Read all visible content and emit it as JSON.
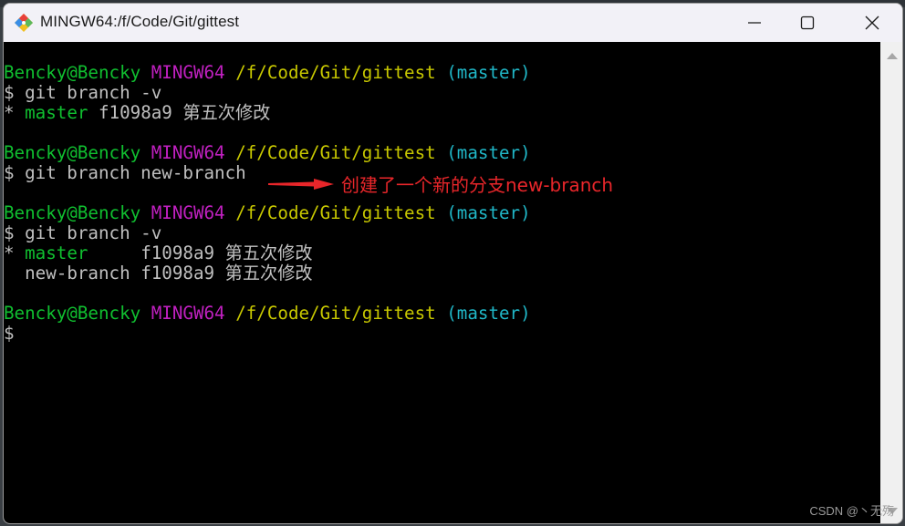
{
  "window": {
    "title": "MINGW64:/f/Code/Git/gittest",
    "app_icon": "git-logo-icon",
    "controls": {
      "minimize": "minimize-icon",
      "maximize": "maximize-icon",
      "close": "close-icon"
    }
  },
  "terminal": {
    "colors": {
      "user": "#10c030",
      "system": "#c020c0",
      "path": "#c8c800",
      "branch": "#20b8c8",
      "text": "#c0c0c0",
      "annotation": "#e8262a"
    },
    "blocks": [
      {
        "prompt": {
          "user": "Bencky@Bencky",
          "system": "MINGW64",
          "path": "/f/Code/Git/gittest",
          "branch": "(master)"
        },
        "command": "$ git branch -v",
        "output": [
          {
            "marker": "* ",
            "branch": "master",
            "pad": " ",
            "hash": "f1098a9",
            "message": "第五次修改",
            "current": true
          }
        ]
      },
      {
        "prompt": {
          "user": "Bencky@Bencky",
          "system": "MINGW64",
          "path": "/f/Code/Git/gittest",
          "branch": "(master)"
        },
        "command": "$ git branch new-branch",
        "output": []
      },
      {
        "prompt": {
          "user": "Bencky@Bencky",
          "system": "MINGW64",
          "path": "/f/Code/Git/gittest",
          "branch": "(master)"
        },
        "command": "$ git branch -v",
        "output": [
          {
            "marker": "* ",
            "branch": "master",
            "pad": "     ",
            "hash": "f1098a9",
            "message": "第五次修改",
            "current": true
          },
          {
            "marker": "  ",
            "branch": "new-branch",
            "pad": " ",
            "hash": "f1098a9",
            "message": "第五次修改",
            "current": false
          }
        ]
      },
      {
        "prompt": {
          "user": "Bencky@Bencky",
          "system": "MINGW64",
          "path": "/f/Code/Git/gittest",
          "branch": "(master)"
        },
        "command": "$",
        "output": []
      }
    ],
    "annotation": "创建了一个新的分支new-branch"
  },
  "watermark": "CSDN @丶无殇"
}
